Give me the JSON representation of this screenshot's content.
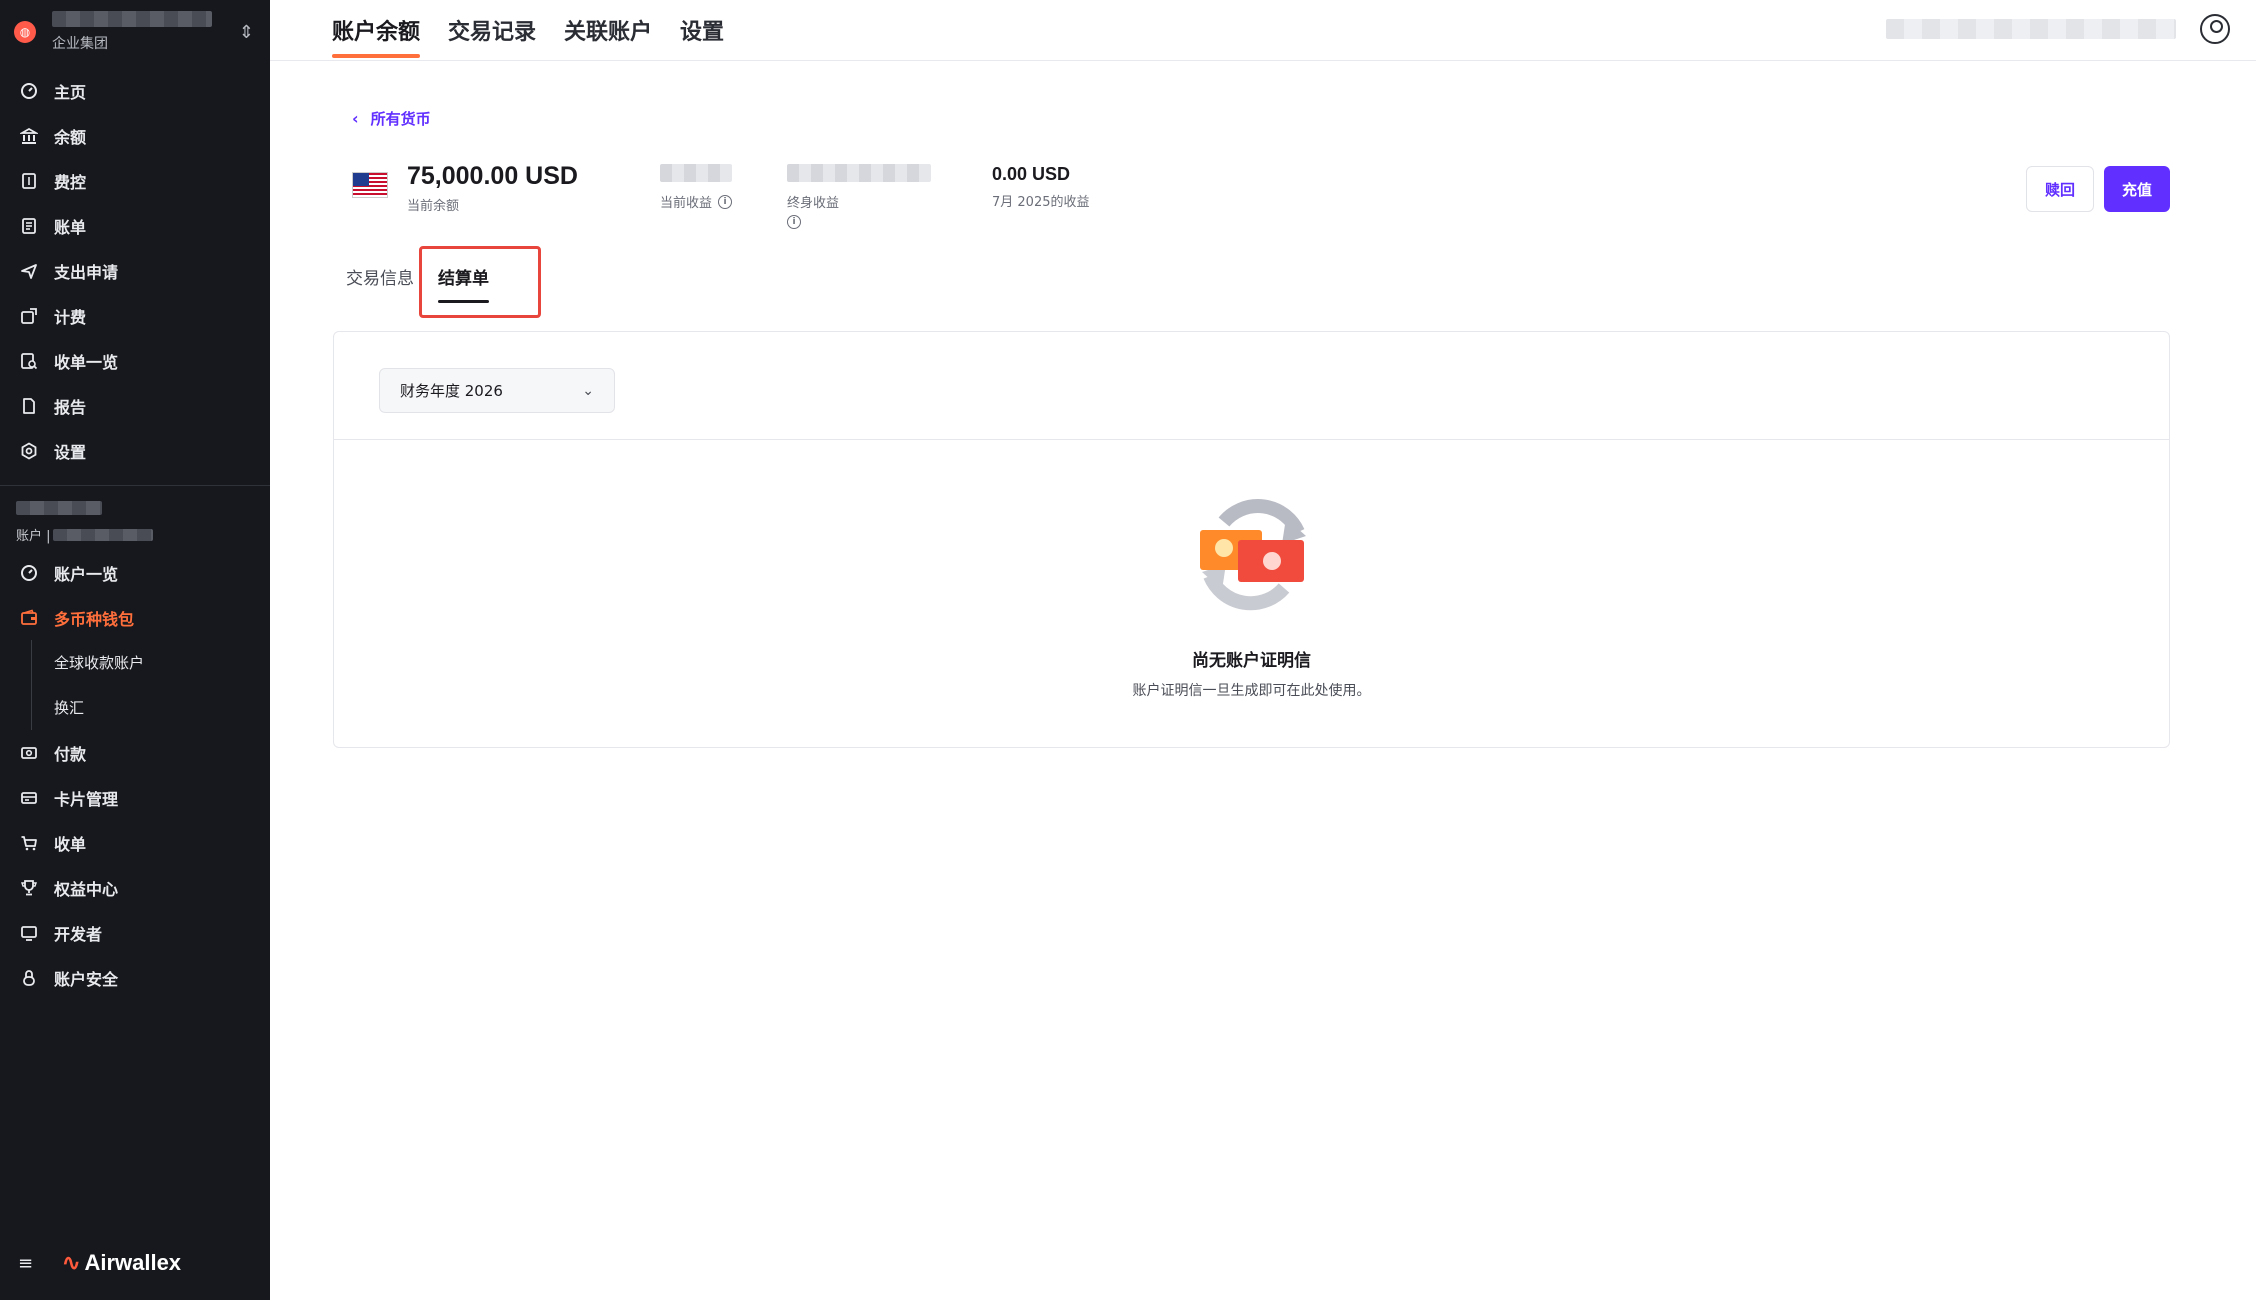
{
  "sidebar": {
    "org_subtitle": "企业集团",
    "nav_items": [
      {
        "label": "主页",
        "icon": "dashboard-icon"
      },
      {
        "label": "余额",
        "icon": "bank-icon"
      },
      {
        "label": "费控",
        "icon": "receipt-icon"
      },
      {
        "label": "账单",
        "icon": "bill-icon"
      },
      {
        "label": "支出申请",
        "icon": "send-icon"
      },
      {
        "label": "计费",
        "icon": "billing-icon"
      },
      {
        "label": "收单一览",
        "icon": "report-search-icon"
      },
      {
        "label": "报告",
        "icon": "document-icon"
      },
      {
        "label": "设置",
        "icon": "gear-icon"
      }
    ],
    "account_subtitle": "账户 | ",
    "account_items": [
      {
        "label": "账户一览",
        "icon": "dashboard-icon"
      },
      {
        "label": "多币种钱包",
        "icon": "wallet-icon",
        "active": true
      },
      {
        "label": "全球收款账户",
        "sub": true
      },
      {
        "label": "换汇",
        "sub": true
      },
      {
        "label": "付款",
        "icon": "payment-icon"
      },
      {
        "label": "卡片管理",
        "icon": "card-icon"
      },
      {
        "label": "收单",
        "icon": "cart-icon"
      },
      {
        "label": "权益中心",
        "icon": "trophy-icon"
      },
      {
        "label": "开发者",
        "icon": "monitor-icon"
      },
      {
        "label": "账户安全",
        "icon": "lock-icon"
      }
    ],
    "brand": "Airwallex"
  },
  "topnav": {
    "tabs": [
      "账户余额",
      "交易记录",
      "关联账户",
      "设置"
    ],
    "active_tab": 0
  },
  "main": {
    "back_label": "所有货币",
    "balance": {
      "amount": "75,000.00 USD",
      "label": "当前余额"
    },
    "metric_current_label": "当前收益",
    "metric_lifetime_label": "终身收益",
    "metric_month": {
      "value": "0.00 USD",
      "label": "7月 2025的收益"
    },
    "btn_redeem": "赎回",
    "btn_topup": "充值",
    "sub_tabs": [
      "交易信息",
      "结算单"
    ],
    "fiscal_select": "财务年度 2026",
    "empty_title": "尚无账户证明信",
    "empty_desc": "账户证明信一旦生成即可在此处使用。"
  },
  "colors": {
    "sidebar_bg": "#16181d",
    "accent_orange": "#ff6f3c",
    "primary_purple": "#612fff",
    "highlight_red": "#e8463c"
  }
}
